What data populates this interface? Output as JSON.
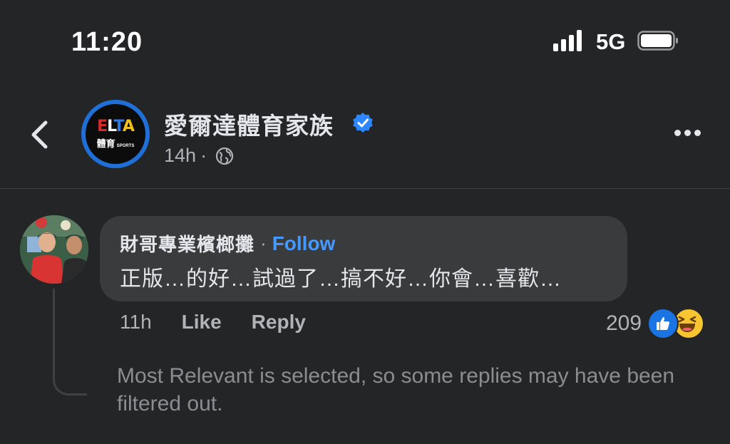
{
  "status_bar": {
    "time": "11:20",
    "network": "5G",
    "icons": [
      "signal-icon",
      "battery-icon"
    ]
  },
  "header": {
    "page_name": "愛爾達體育家族",
    "verified_icon": "verified-badge-icon",
    "age": "14h",
    "separator": "·",
    "privacy_icon": "globe-icon",
    "logo_text": {
      "brand": "ELTA",
      "sub": "體育",
      "tag": "SPORTS"
    }
  },
  "comment": {
    "author": "財哥專業檳榔攤",
    "separator": "·",
    "follow_label": "Follow",
    "text": "正版…的好…試過了…搞不好…你會…喜歡…",
    "age": "11h",
    "like_label": "Like",
    "reply_label": "Reply",
    "reaction_count": "209",
    "reaction_icons": [
      "like-reaction-icon",
      "haha-reaction-icon"
    ]
  },
  "notice": "Most Relevant is selected, so some replies may have been filtered out.",
  "colors": {
    "background": "#242526",
    "bubble": "#3a3b3c",
    "accent": "#4599ff",
    "text_primary": "#e4e6eb",
    "text_secondary": "#b0b3b8"
  }
}
